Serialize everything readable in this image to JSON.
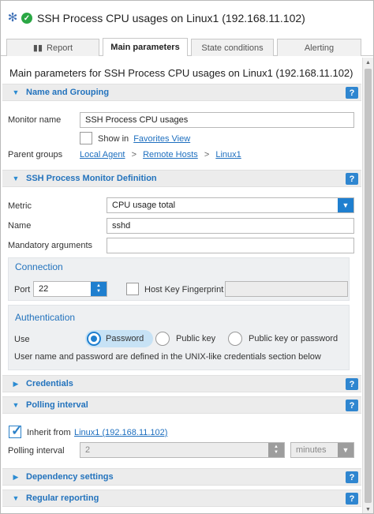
{
  "header": {
    "title": "SSH Process CPU usages on Linux1 (192.168.11.102)",
    "icons": [
      "gear-icon",
      "status-ok-icon"
    ]
  },
  "tabs": [
    {
      "label": "Report",
      "icon": "bar-chart-icon"
    },
    {
      "label": "Main parameters"
    },
    {
      "label": "State conditions"
    },
    {
      "label": "Alerting"
    }
  ],
  "page_title": "Main parameters for SSH Process CPU usages on Linux1 (192.168.11.102)",
  "sections": {
    "name_grouping": "Name and Grouping",
    "definition": "SSH Process Monitor Definition",
    "credentials": "Credentials",
    "polling": "Polling interval",
    "dependency": "Dependency settings",
    "reporting": "Regular reporting"
  },
  "help_label": "?",
  "name_grouping": {
    "monitor_name_label": "Monitor name",
    "monitor_name_value": "SSH Process CPU usages",
    "show_in_label": "Show in",
    "favorites_link": "Favorites View",
    "parent_groups_label": "Parent groups",
    "breadcrumb": [
      "Local Agent",
      "Remote Hosts",
      "Linux1"
    ],
    "breadcrumb_sep": ">"
  },
  "definition": {
    "metric_label": "Metric",
    "metric_value": "CPU usage total",
    "name_label": "Name",
    "name_value": "sshd",
    "mandatory_label": "Mandatory arguments",
    "mandatory_value": ""
  },
  "connection": {
    "title": "Connection",
    "port_label": "Port",
    "port_value": "22",
    "host_key_label": "Host Key Fingerprint",
    "host_key_value": ""
  },
  "authentication": {
    "title": "Authentication",
    "use_label": "Use",
    "options": [
      "Password",
      "Public key",
      "Public key or password"
    ],
    "selected": "Password",
    "note": "User name and password are defined in the UNIX-like credentials section below"
  },
  "polling": {
    "inherit_label": "Inherit from",
    "inherit_link": "Linux1 (192.168.11.102)",
    "interval_label": "Polling interval",
    "interval_value": "2",
    "unit_value": "minutes"
  },
  "colors": {
    "accent": "#1f7fcf",
    "section_label": "#2373bd",
    "link": "#1e6fbf",
    "ok": "#2aa744"
  }
}
